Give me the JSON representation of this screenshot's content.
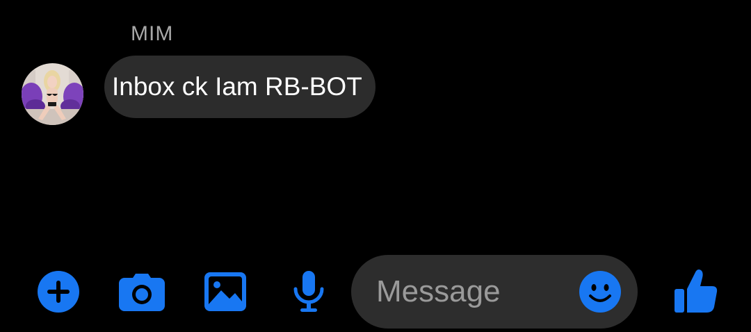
{
  "thread": {
    "sender_name": "MIM",
    "message_text": "Inbox ck Iam RB-BOT"
  },
  "composer": {
    "placeholder": "Message",
    "icons": [
      "plus-icon",
      "camera-icon",
      "image-icon",
      "microphone-icon",
      "emoji-icon",
      "thumbs-up-icon"
    ]
  },
  "colors": {
    "accent": "#1877f2",
    "background": "#000000",
    "bubble": "#2c2c2c",
    "input": "#2d2d2d"
  }
}
